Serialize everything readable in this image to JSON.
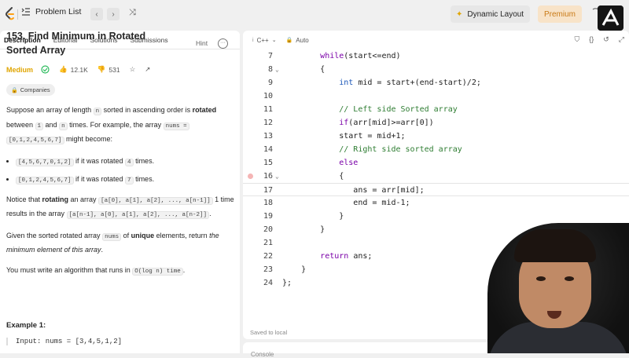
{
  "topbar": {
    "problem_list_label": "Problem List",
    "dynamic_layout_label": "Dynamic Layout",
    "premium_label": "Premium"
  },
  "tabs": [
    "Description",
    "Editorial",
    "Solutions",
    "Submissions"
  ],
  "problem": {
    "title": "153. Find Minimum in Rotated Sorted Array",
    "hint_label": "Hint",
    "difficulty": "Medium",
    "likes": "12.1K",
    "dislikes": "531",
    "companies_label": "Companies"
  },
  "description": {
    "p1_a": "Suppose an array of length ",
    "p1_n": "n",
    "p1_b": " sorted in ascending order is ",
    "p1_bold": "rotated",
    "p1_c": " between ",
    "p1_one": "1",
    "p1_d": " and ",
    "p1_n2": "n",
    "p1_e": " times. For example, the array ",
    "p1_nums": "nums =",
    "p1_arr": "[0,1,2,4,5,6,7]",
    "p1_f": " might become:",
    "bullet1_code": "[4,5,6,7,0,1,2]",
    "bullet1_a": " if it was rotated ",
    "bullet1_num": "4",
    "bullet1_b": " times.",
    "bullet2_code": "[0,1,2,4,5,6,7]",
    "bullet2_a": " if it was rotated ",
    "bullet2_num": "7",
    "bullet2_b": " times.",
    "p2_a": "Notice that ",
    "p2_bold": "rotating",
    "p2_b": " an array ",
    "p2_code1": "[a[0], a[1], a[2], ..., a[n-1]]",
    "p2_c": " 1 time results in the array ",
    "p2_code2": "[a[n-1], a[0], a[1], a[2], ..., a[n-2]]",
    "p2_d": ".",
    "p3_a": "Given the sorted rotated array ",
    "p3_code": "nums",
    "p3_b": " of ",
    "p3_bold": "unique",
    "p3_c": " elements, return ",
    "p3_italic": "the minimum element of this array",
    "p3_d": ".",
    "p4_a": "You must write an algorithm that runs in ",
    "p4_code": "O(log n) time",
    "p4_b": ".",
    "example_title": "Example 1:",
    "example_input": "Input: nums = [3,4,5,1,2]"
  },
  "editor": {
    "language": "C++",
    "mode": "Auto",
    "saved_label": "Saved to local",
    "console_label": "Console"
  },
  "code_lines": [
    {
      "n": "7",
      "t": "        while(start<=end)"
    },
    {
      "n": "8",
      "t": "        {"
    },
    {
      "n": "9",
      "t": "            int mid = start+(end-start)/2;"
    },
    {
      "n": "10",
      "t": ""
    },
    {
      "n": "11",
      "t": "            // Left side Sorted array"
    },
    {
      "n": "12",
      "t": "            if(arr[mid]>=arr[0])"
    },
    {
      "n": "13",
      "t": "            start = mid+1;"
    },
    {
      "n": "14",
      "t": "            // Right side sorted array"
    },
    {
      "n": "15",
      "t": "            else"
    },
    {
      "n": "16",
      "t": "            {"
    },
    {
      "n": "17",
      "t": "               ans = arr[mid];"
    },
    {
      "n": "18",
      "t": "               end = mid-1;"
    },
    {
      "n": "19",
      "t": "            }"
    },
    {
      "n": "20",
      "t": "        }"
    },
    {
      "n": "21",
      "t": ""
    },
    {
      "n": "22",
      "t": "        return ans;"
    },
    {
      "n": "23",
      "t": "    }"
    },
    {
      "n": "24",
      "t": "};"
    }
  ]
}
